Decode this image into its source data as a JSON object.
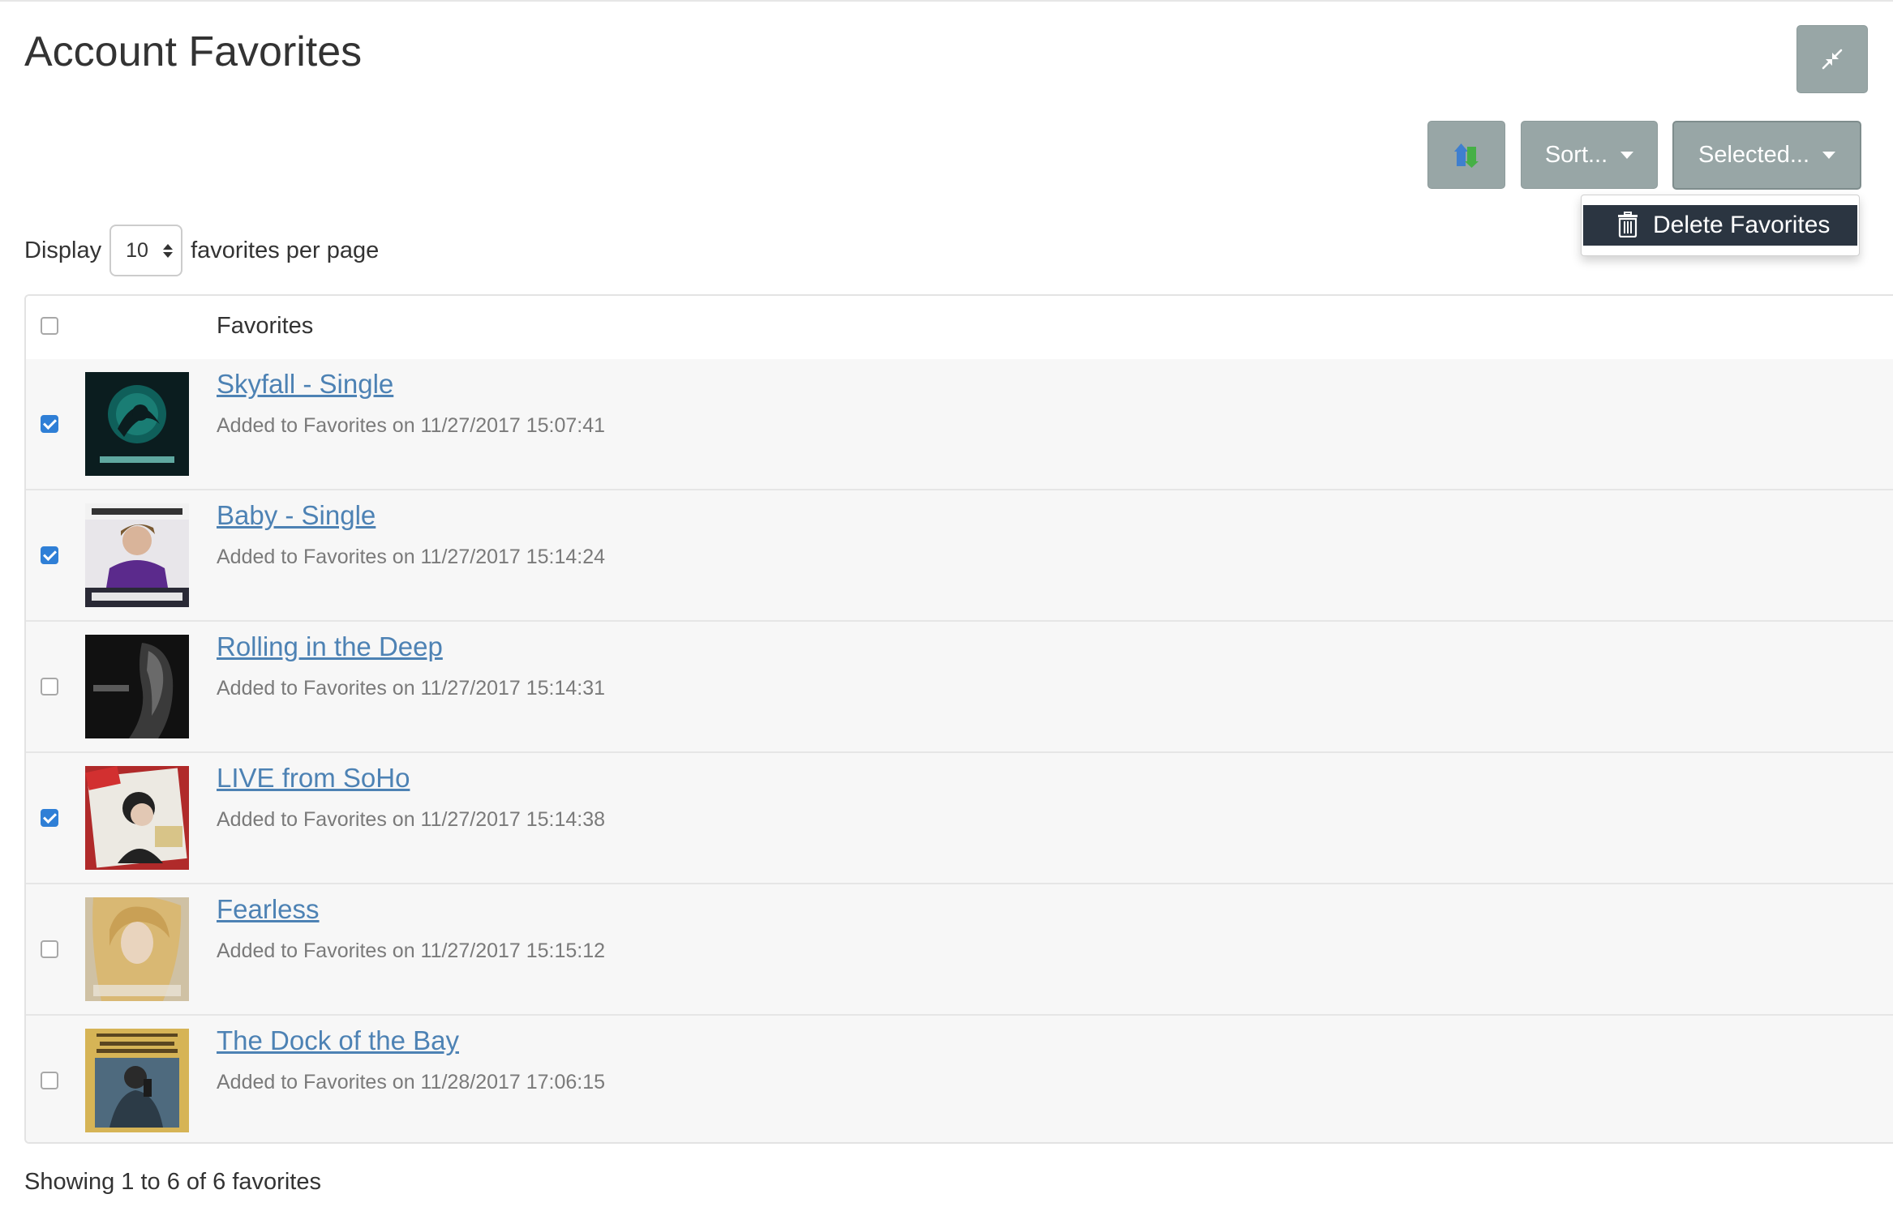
{
  "page": {
    "title": "Account Favorites"
  },
  "toolbar": {
    "collapse_icon": "compress-icon",
    "export_icon": "export-icon",
    "sort_label": "Sort...",
    "selected_label": "Selected...",
    "dropdown": {
      "delete_label": "Delete Favorites",
      "delete_icon": "trash-icon"
    }
  },
  "display": {
    "prefix": "Display",
    "per_page": "10",
    "suffix": "favorites per page"
  },
  "table": {
    "header": "Favorites",
    "rows": [
      {
        "title": "Skyfall - Single",
        "added": "Added to Favorites on 11/27/2017 15:07:41",
        "checked": true
      },
      {
        "title": "Baby - Single",
        "added": "Added to Favorites on 11/27/2017 15:14:24",
        "checked": true
      },
      {
        "title": "Rolling in the Deep",
        "added": "Added to Favorites on 11/27/2017 15:14:31",
        "checked": false
      },
      {
        "title": "LIVE from SoHo",
        "added": "Added to Favorites on 11/27/2017 15:14:38",
        "checked": true
      },
      {
        "title": "Fearless",
        "added": "Added to Favorites on 11/27/2017 15:15:12",
        "checked": false
      },
      {
        "title": "The Dock of the Bay",
        "added": "Added to Favorites on 11/28/2017 17:06:15",
        "checked": false
      }
    ]
  },
  "footer": {
    "showing": "Showing 1 to 6 of 6 favorites"
  },
  "colors": {
    "link": "#4d82b4",
    "button": "#98a6a6",
    "dropdown_item": "#2b3541",
    "checkbox": "#2f7fd6"
  }
}
